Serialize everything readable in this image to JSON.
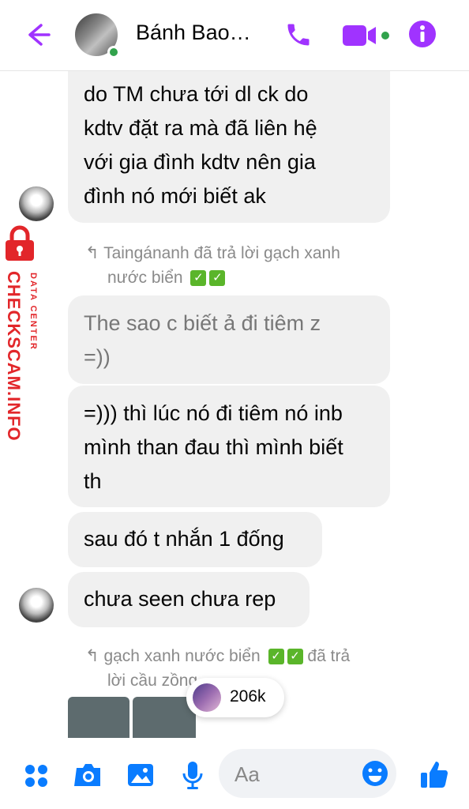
{
  "header": {
    "contact_name": "Bánh Bao…",
    "icons": [
      "back-arrow-icon",
      "phone-icon",
      "video-camera-icon",
      "info-icon"
    ]
  },
  "messages": [
    {
      "lines": [
        "do TM chưa tới dl ck do",
        "kdtv đặt ra mà đã liên hệ",
        "với gia đình kdtv nên gia",
        "đình nó mới biết ak"
      ]
    },
    {
      "lines": [
        "The sao c biết ả đi tiêm z",
        "=))"
      ]
    },
    {
      "lines": [
        "=))) thì lúc nó đi tiêm nó inb",
        "mình than đau thì mình biết",
        "th"
      ]
    },
    {
      "lines": [
        "sau đó t nhắn 1 đống"
      ]
    },
    {
      "lines": [
        "chưa seen chưa rep"
      ]
    }
  ],
  "replies": [
    {
      "line1": "Taingánanh đã trả lời gạch xanh",
      "line2": "nước biển"
    },
    {
      "line1": "gạch xanh nước biển",
      "line1b": "đã trả",
      "line2": "lời cầu zồng"
    }
  ],
  "reply_count": "206k",
  "watermark": {
    "site": "CHECKSCAM.INFO",
    "sub": "DATA CENTER"
  },
  "composer": {
    "placeholder": "Aa",
    "icons": [
      "apps-icon",
      "camera-icon",
      "gallery-icon",
      "microphone-icon",
      "emoji-icon",
      "thumbs-up-icon"
    ]
  },
  "colors": {
    "accent": "#a033ff",
    "blue": "#0a7cff",
    "bubble": "#f0f0f0",
    "watermark": "#e2262a"
  }
}
